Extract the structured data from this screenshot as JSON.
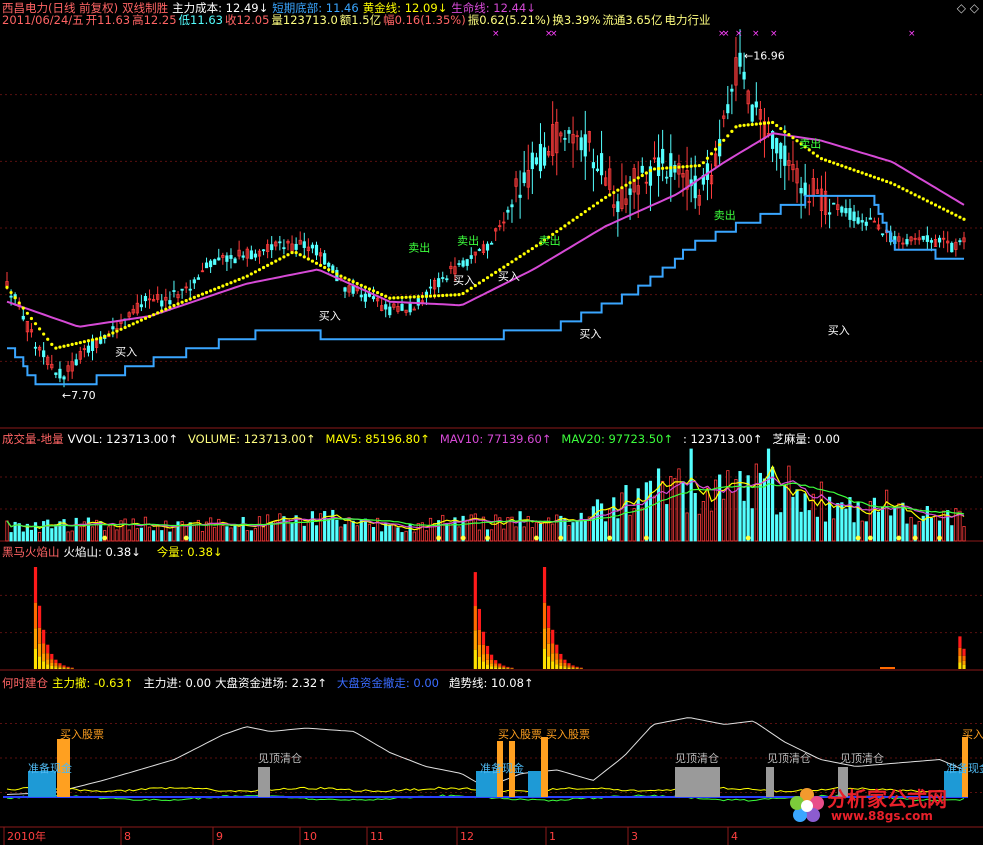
{
  "window": {
    "corner_icons": "◇ ◇"
  },
  "header_main": {
    "stock": "西昌电力(日线 前复权)",
    "indicator": "双线制胜",
    "main_cost": "主力成本: 12.49↓",
    "short_bottom": "短期底部: 11.46",
    "gold_line": "黄金线: 12.09↓",
    "life_line": "生命线: 12.44↓"
  },
  "header_quote": {
    "date": "2011/06/24/五",
    "open": "开11.63",
    "high": "高12.25",
    "low": "低11.63",
    "close": "收12.05",
    "vol": "量123713.0",
    "amount": "额1.5亿",
    "change": "幅0.16(1.35%)",
    "amplitude": "振0.62(5.21%)",
    "turnover": "换3.39%",
    "float": "流通3.65亿",
    "industry": "电力行业"
  },
  "price_annotations": {
    "high_label": "16.96",
    "low_label": "7.70",
    "buy": "买入",
    "sell": "卖出"
  },
  "header_volume": {
    "title": "成交量-地量",
    "vvol": "VVOL: 123713.00↑",
    "volume": "VOLUME: 123713.00↑",
    "mav5": "MAV5: 85196.80↑",
    "mav10": "MAV10: 77139.60↑",
    "mav20": "MAV20: 97723.50↑",
    "blank": ": 123713.00↑",
    "sesame": "芝麻量: 0.00"
  },
  "header_fire": {
    "title": "黑马火焰山",
    "fire": "火焰山: 0.38↓",
    "today": "今量: 0.38↓"
  },
  "header_bottom": {
    "title": "何时建仓",
    "main_out": "主力撤: -0.63↑",
    "main_in": "主力进: 0.00",
    "market_in": "大盘资金进场: 2.32↑",
    "market_out": "大盘资金撤走: 0.00",
    "trend": "趋势线: 10.08↑"
  },
  "bottom_labels": {
    "buy_stock": "买入股票",
    "top_clear": "见顶清仓",
    "prepare": "准备现金"
  },
  "time_axis": [
    "2010年",
    "8",
    "9",
    "10",
    "11",
    "12",
    "1",
    "3",
    "4"
  ],
  "watermark": {
    "name": "分析家公式网",
    "url": "www.88gs.com"
  },
  "colors": {
    "up": "#ff3c3c",
    "down": "#54ffff",
    "gold": "#ffff00",
    "life": "#d64ad6",
    "support": "#3aa6ff",
    "grid": "#8b1a1a"
  },
  "chart_data": {
    "type": "candlestick",
    "panels": [
      "price",
      "volume",
      "fire",
      "bottom"
    ],
    "price_range": [
      7.7,
      16.96
    ],
    "summary": {
      "date": "2011/06/24",
      "open": 11.63,
      "high": 12.25,
      "low": 11.63,
      "close": 12.05,
      "volume": 123713.0
    },
    "lines": {
      "main_cost": 12.49,
      "short_bottom": 11.46,
      "gold_line": 12.09,
      "life_line": 12.44,
      "mav5": 85196.8,
      "mav10": 77139.6,
      "mav20": 97723.5,
      "fire": 0.38,
      "today_vol": 0.38,
      "main_out": -0.63,
      "main_in": 0.0,
      "market_in": 2.32,
      "market_out": 0.0,
      "trend": 10.08
    }
  }
}
